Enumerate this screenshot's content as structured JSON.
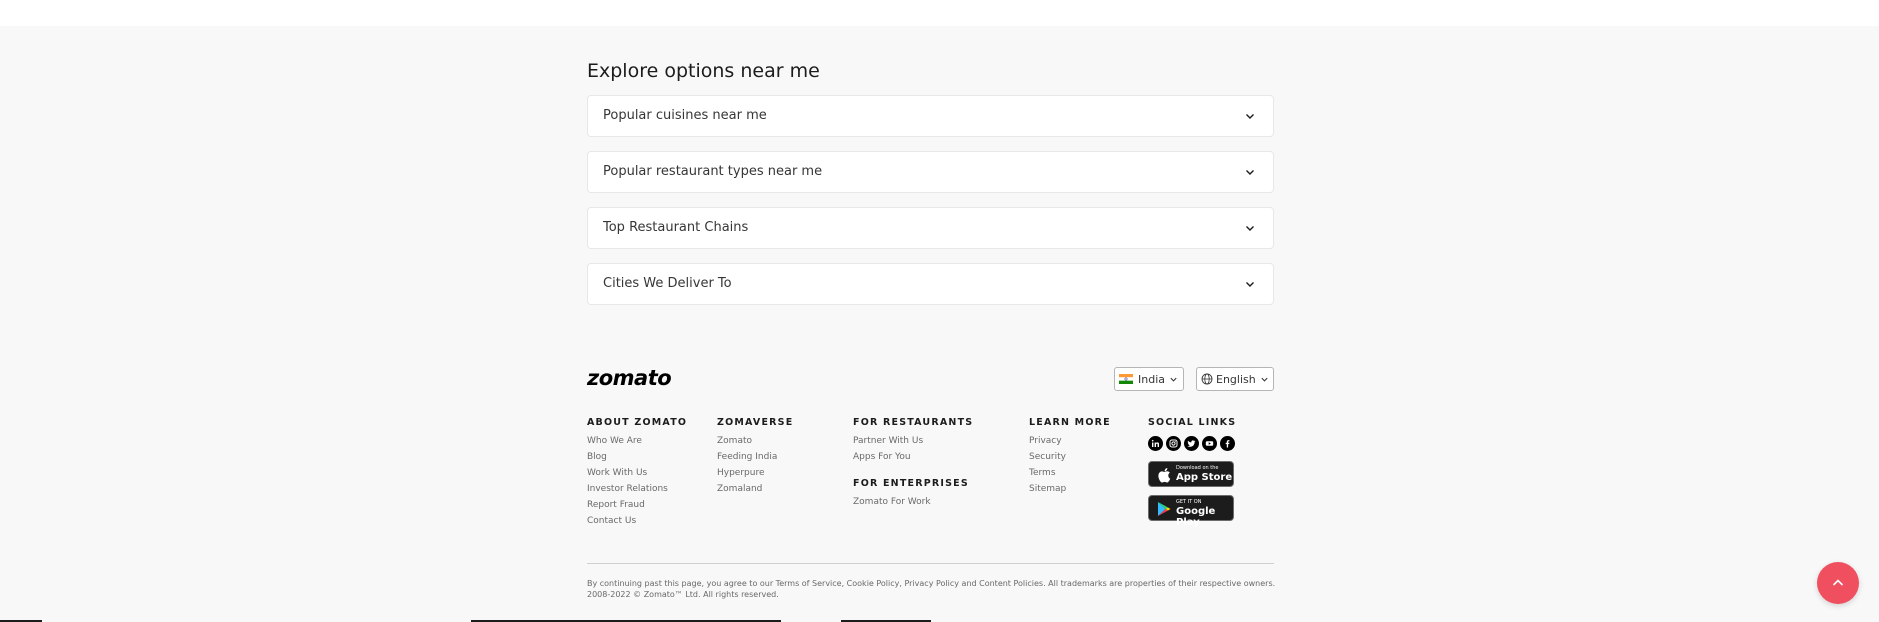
{
  "explore": {
    "title": "Explore options near me",
    "accordions": [
      {
        "label": "Popular cuisines near me"
      },
      {
        "label": "Popular restaurant types near me"
      },
      {
        "label": "Top Restaurant Chains"
      },
      {
        "label": "Cities We Deliver To"
      }
    ]
  },
  "footer": {
    "logo": "zomato",
    "country_select": "India",
    "language_select": "English",
    "columns": {
      "about": {
        "heading": "ABOUT ZOMATO",
        "links": [
          "Who We Are",
          "Blog",
          "Work With Us",
          "Investor Relations",
          "Report Fraud",
          "Contact Us"
        ]
      },
      "zomaverse": {
        "heading": "ZOMAVERSE",
        "links": [
          "Zomato",
          "Feeding India",
          "Hyperpure",
          "Zomaland"
        ]
      },
      "restaurants": {
        "heading": "FOR RESTAURANTS",
        "links": [
          "Partner With Us",
          "Apps For You"
        ]
      },
      "enterprises": {
        "heading": "FOR ENTERPRISES",
        "links": [
          "Zomato For Work"
        ]
      },
      "learn": {
        "heading": "LEARN MORE",
        "links": [
          "Privacy",
          "Security",
          "Terms",
          "Sitemap"
        ]
      },
      "social": {
        "heading": "SOCIAL LINKS",
        "icons": [
          "linkedin-icon",
          "instagram-icon",
          "twitter-icon",
          "youtube-icon",
          "facebook-icon"
        ]
      }
    },
    "app_store": {
      "small": "Download on the",
      "big": "App Store"
    },
    "google_play": {
      "small": "GET IT ON",
      "big": "Google Play"
    },
    "legal": "By continuing past this page, you agree to our Terms of Service, Cookie Policy, Privacy Policy and Content Policies. All trademarks are properties of their respective owners. 2008-2022 © Zomato™ Ltd. All rights reserved."
  },
  "colors": {
    "accent": "#ef4f5f",
    "bg": "#f8f8f8",
    "text": "#1c1c1c",
    "muted": "#696969"
  }
}
